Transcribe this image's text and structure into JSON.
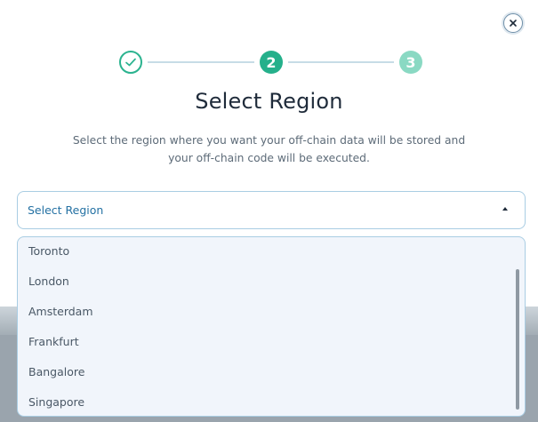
{
  "modal": {
    "close_label": "×"
  },
  "stepper": {
    "steps": [
      {
        "label": "✓",
        "state": "completed"
      },
      {
        "label": "2",
        "state": "current"
      },
      {
        "label": "3",
        "state": "upcoming"
      }
    ],
    "colors": {
      "completed": "#2bb38f",
      "current": "#25b08b",
      "upcoming": "#8ad9c3"
    }
  },
  "title": "Select Region",
  "subtitle": "Select the region where you want your off-chain data will be stored and your off-chain code will be executed.",
  "region_select": {
    "value": "Select Region",
    "expanded": true,
    "options": [
      "Toronto",
      "London",
      "Amsterdam",
      "Frankfurt",
      "Bangalore",
      "Singapore"
    ]
  },
  "icons": {
    "close": "close-icon",
    "check": "check-icon",
    "caret": "caret-up-icon"
  }
}
